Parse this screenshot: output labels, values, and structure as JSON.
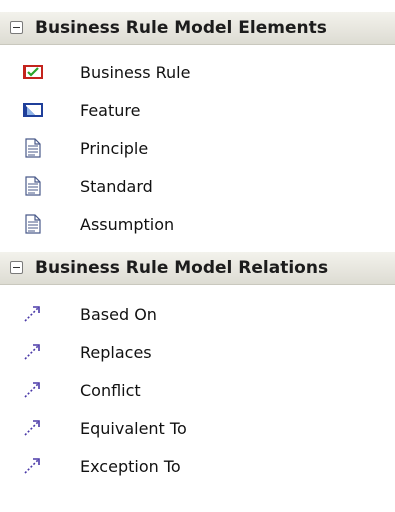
{
  "elements_section": {
    "title": "Business Rule Model Elements",
    "collapse_icon": "minus-box-icon",
    "items": [
      {
        "label": "Business Rule",
        "icon": "business-rule-icon"
      },
      {
        "label": "Feature",
        "icon": "feature-icon"
      },
      {
        "label": "Principle",
        "icon": "document-icon"
      },
      {
        "label": "Standard",
        "icon": "document-icon"
      },
      {
        "label": "Assumption",
        "icon": "document-icon"
      }
    ]
  },
  "relations_section": {
    "title": "Business Rule Model Relations",
    "collapse_icon": "minus-box-icon",
    "items": [
      {
        "label": "Based On",
        "icon": "dashed-arrow-icon"
      },
      {
        "label": "Replaces",
        "icon": "dashed-arrow-icon"
      },
      {
        "label": "Conflict",
        "icon": "dashed-arrow-icon"
      },
      {
        "label": "Equivalent To",
        "icon": "dashed-arrow-icon"
      },
      {
        "label": "Exception To",
        "icon": "dashed-arrow-icon"
      }
    ]
  },
  "colors": {
    "header_bg": "#e6e5dc",
    "business_rule_red": "#c4241d",
    "check_green": "#2aa52a",
    "feature_blue": "#1f3f9a",
    "arrow_purple": "#4b3aa8"
  }
}
